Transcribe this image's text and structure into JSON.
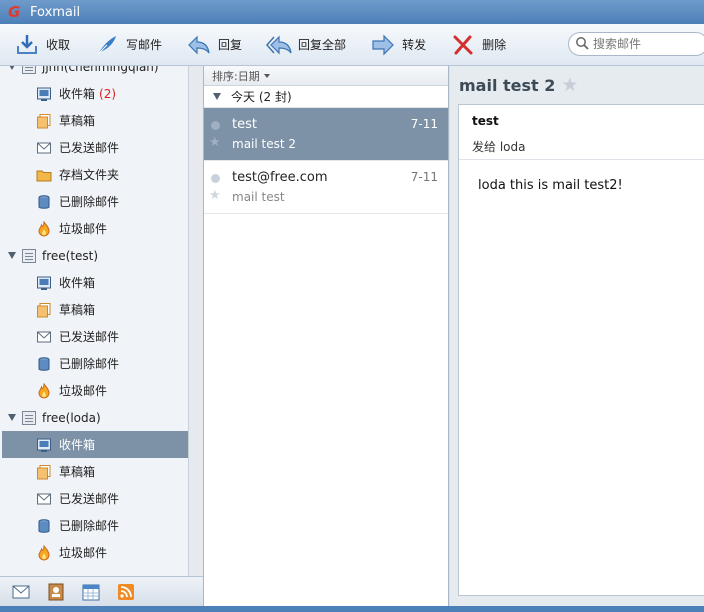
{
  "window": {
    "title": "Foxmail"
  },
  "toolbar": {
    "receive": "收取",
    "compose": "写邮件",
    "reply": "回复",
    "reply_all": "回复全部",
    "forward": "转发",
    "delete": "删除",
    "search_placeholder": "搜索邮件"
  },
  "accounts": [
    {
      "name": "jjnh(chenmingqian)",
      "folders": [
        {
          "label": "收件箱",
          "count": "(2)",
          "icon": "inbox-icon"
        },
        {
          "label": "草稿箱",
          "icon": "drafts-icon"
        },
        {
          "label": "已发送邮件",
          "icon": "sent-icon"
        },
        {
          "label": "存档文件夹",
          "icon": "archive-folder-icon"
        },
        {
          "label": "已删除邮件",
          "icon": "trash-icon"
        },
        {
          "label": "垃圾邮件",
          "icon": "junk-icon"
        }
      ]
    },
    {
      "name": "free(test)",
      "folders": [
        {
          "label": "收件箱",
          "icon": "inbox-icon"
        },
        {
          "label": "草稿箱",
          "icon": "drafts-icon"
        },
        {
          "label": "已发送邮件",
          "icon": "sent-icon"
        },
        {
          "label": "已删除邮件",
          "icon": "trash-icon"
        },
        {
          "label": "垃圾邮件",
          "icon": "junk-icon"
        }
      ]
    },
    {
      "name": "free(loda)",
      "folders": [
        {
          "label": "收件箱",
          "icon": "inbox-icon",
          "selected": true
        },
        {
          "label": "草稿箱",
          "icon": "drafts-icon"
        },
        {
          "label": "已发送邮件",
          "icon": "sent-icon"
        },
        {
          "label": "已删除邮件",
          "icon": "trash-icon"
        },
        {
          "label": "垃圾邮件",
          "icon": "junk-icon"
        }
      ]
    }
  ],
  "bottom_bar": [
    "mail-view-icon",
    "contacts-icon",
    "calendar-icon",
    "rss-icon"
  ],
  "list": {
    "sort_label": "排序:日期",
    "group_label": "今天 (2 封)",
    "messages": [
      {
        "sender": "test",
        "date": "7-11",
        "subject": "mail test 2",
        "selected": true
      },
      {
        "sender": "test@free.com",
        "date": "7-11",
        "subject": "mail test",
        "selected": false
      }
    ]
  },
  "reader": {
    "title": "mail test 2",
    "from": "test",
    "to": "发给 loda",
    "body": "loda this is mail test2!"
  },
  "colors": {
    "selection": "#7e92a7",
    "titlebar": "#4d7fb8",
    "unread_count": "#e02020"
  }
}
